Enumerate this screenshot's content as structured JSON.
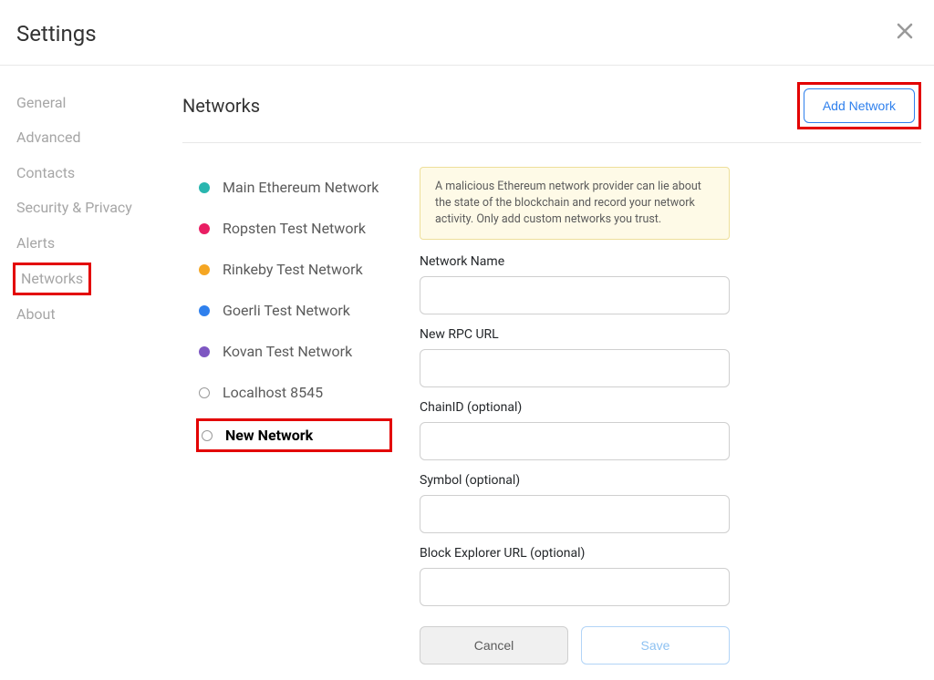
{
  "header": {
    "title": "Settings"
  },
  "sidebar": {
    "items": [
      {
        "label": "General"
      },
      {
        "label": "Advanced"
      },
      {
        "label": "Contacts"
      },
      {
        "label": "Security & Privacy"
      },
      {
        "label": "Alerts"
      },
      {
        "label": "Networks"
      },
      {
        "label": "About"
      }
    ]
  },
  "networks": {
    "heading": "Networks",
    "add_button": "Add Network",
    "items": [
      {
        "label": "Main Ethereum Network",
        "color": "#29B6AF",
        "variant": "dot"
      },
      {
        "label": "Ropsten Test Network",
        "color": "#E91E63",
        "variant": "dot"
      },
      {
        "label": "Rinkeby Test Network",
        "color": "#F5A623",
        "variant": "dot"
      },
      {
        "label": "Goerli Test Network",
        "color": "#2F80ED",
        "variant": "dot"
      },
      {
        "label": "Kovan Test Network",
        "color": "#7E57C2",
        "variant": "dot"
      },
      {
        "label": "Localhost 8545",
        "color": "",
        "variant": "ring"
      },
      {
        "label": "New Network",
        "color": "",
        "variant": "ring"
      }
    ]
  },
  "form": {
    "warning": "A malicious Ethereum network provider can lie about the state of the blockchain and record your network activity. Only add custom networks you trust.",
    "network_name_label": "Network Name",
    "rpc_url_label": "New RPC URL",
    "chain_id_label": "ChainID (optional)",
    "symbol_label": "Symbol (optional)",
    "explorer_label": "Block Explorer URL (optional)",
    "cancel": "Cancel",
    "save": "Save"
  }
}
